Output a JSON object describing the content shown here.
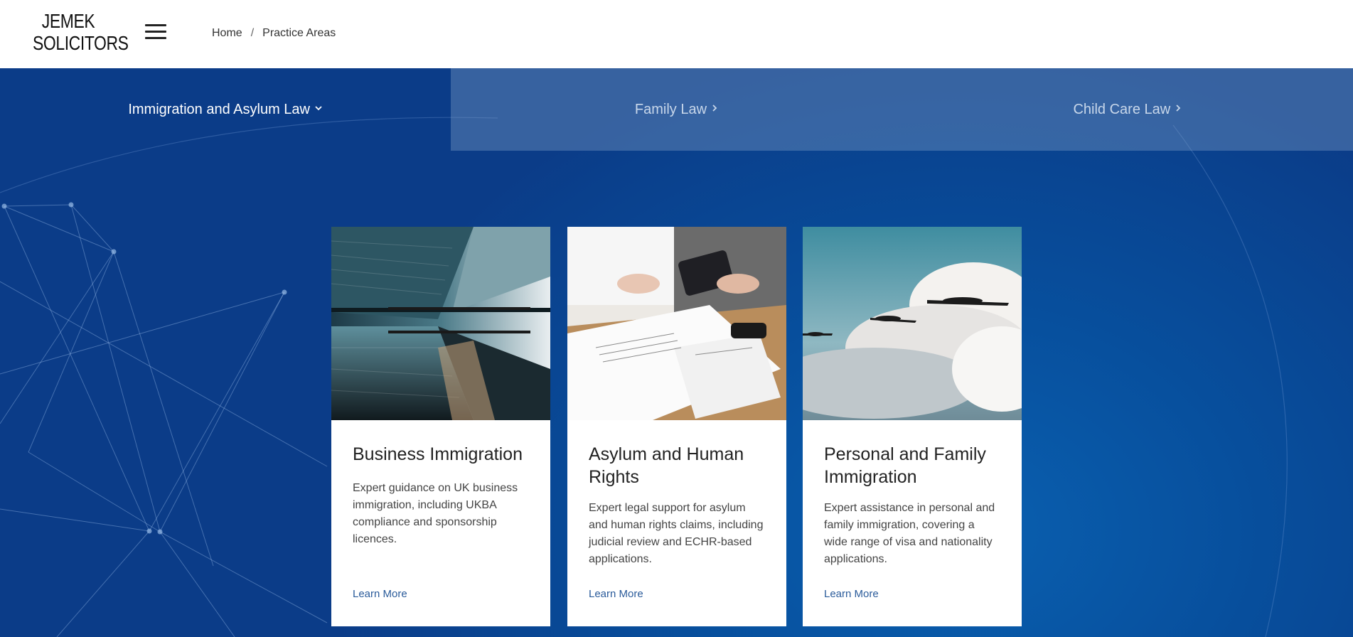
{
  "header": {
    "logo_line1": "JEMEK",
    "logo_line2": "SOLICITORS",
    "breadcrumb": {
      "home": "Home",
      "separator": "/",
      "current": "Practice Areas"
    }
  },
  "tabs": [
    {
      "label": "Immigration and Asylum Law",
      "chevron": "⌄",
      "active": true
    },
    {
      "label": "Family Law",
      "chevron": "›",
      "active": false
    },
    {
      "label": "Child Care Law",
      "chevron": "›",
      "active": false
    }
  ],
  "cards": [
    {
      "title": "Business Immigration",
      "description": "Expert guidance on UK business immigration, including UKBA compliance and sponsorship licences.",
      "link": "Learn More",
      "image": "skyscraper-reflection-photo"
    },
    {
      "title": "Asylum and Human Rights",
      "description": "Expert legal support for asylum and human rights claims, including judicial review and ECHR-based applications.",
      "link": "Learn More",
      "image": "documents-meeting-photo"
    },
    {
      "title": "Personal and Family Immigration",
      "description": "Expert assistance in personal and family immigration, covering a wide range of visa and nationality applications.",
      "link": "Learn More",
      "image": "planes-clouds-photo"
    }
  ],
  "colors": {
    "hero_blue": "#074f9d",
    "link_blue": "#2a5b9a",
    "inactive_tab_overlay": "rgba(130,160,200,0.38)"
  }
}
